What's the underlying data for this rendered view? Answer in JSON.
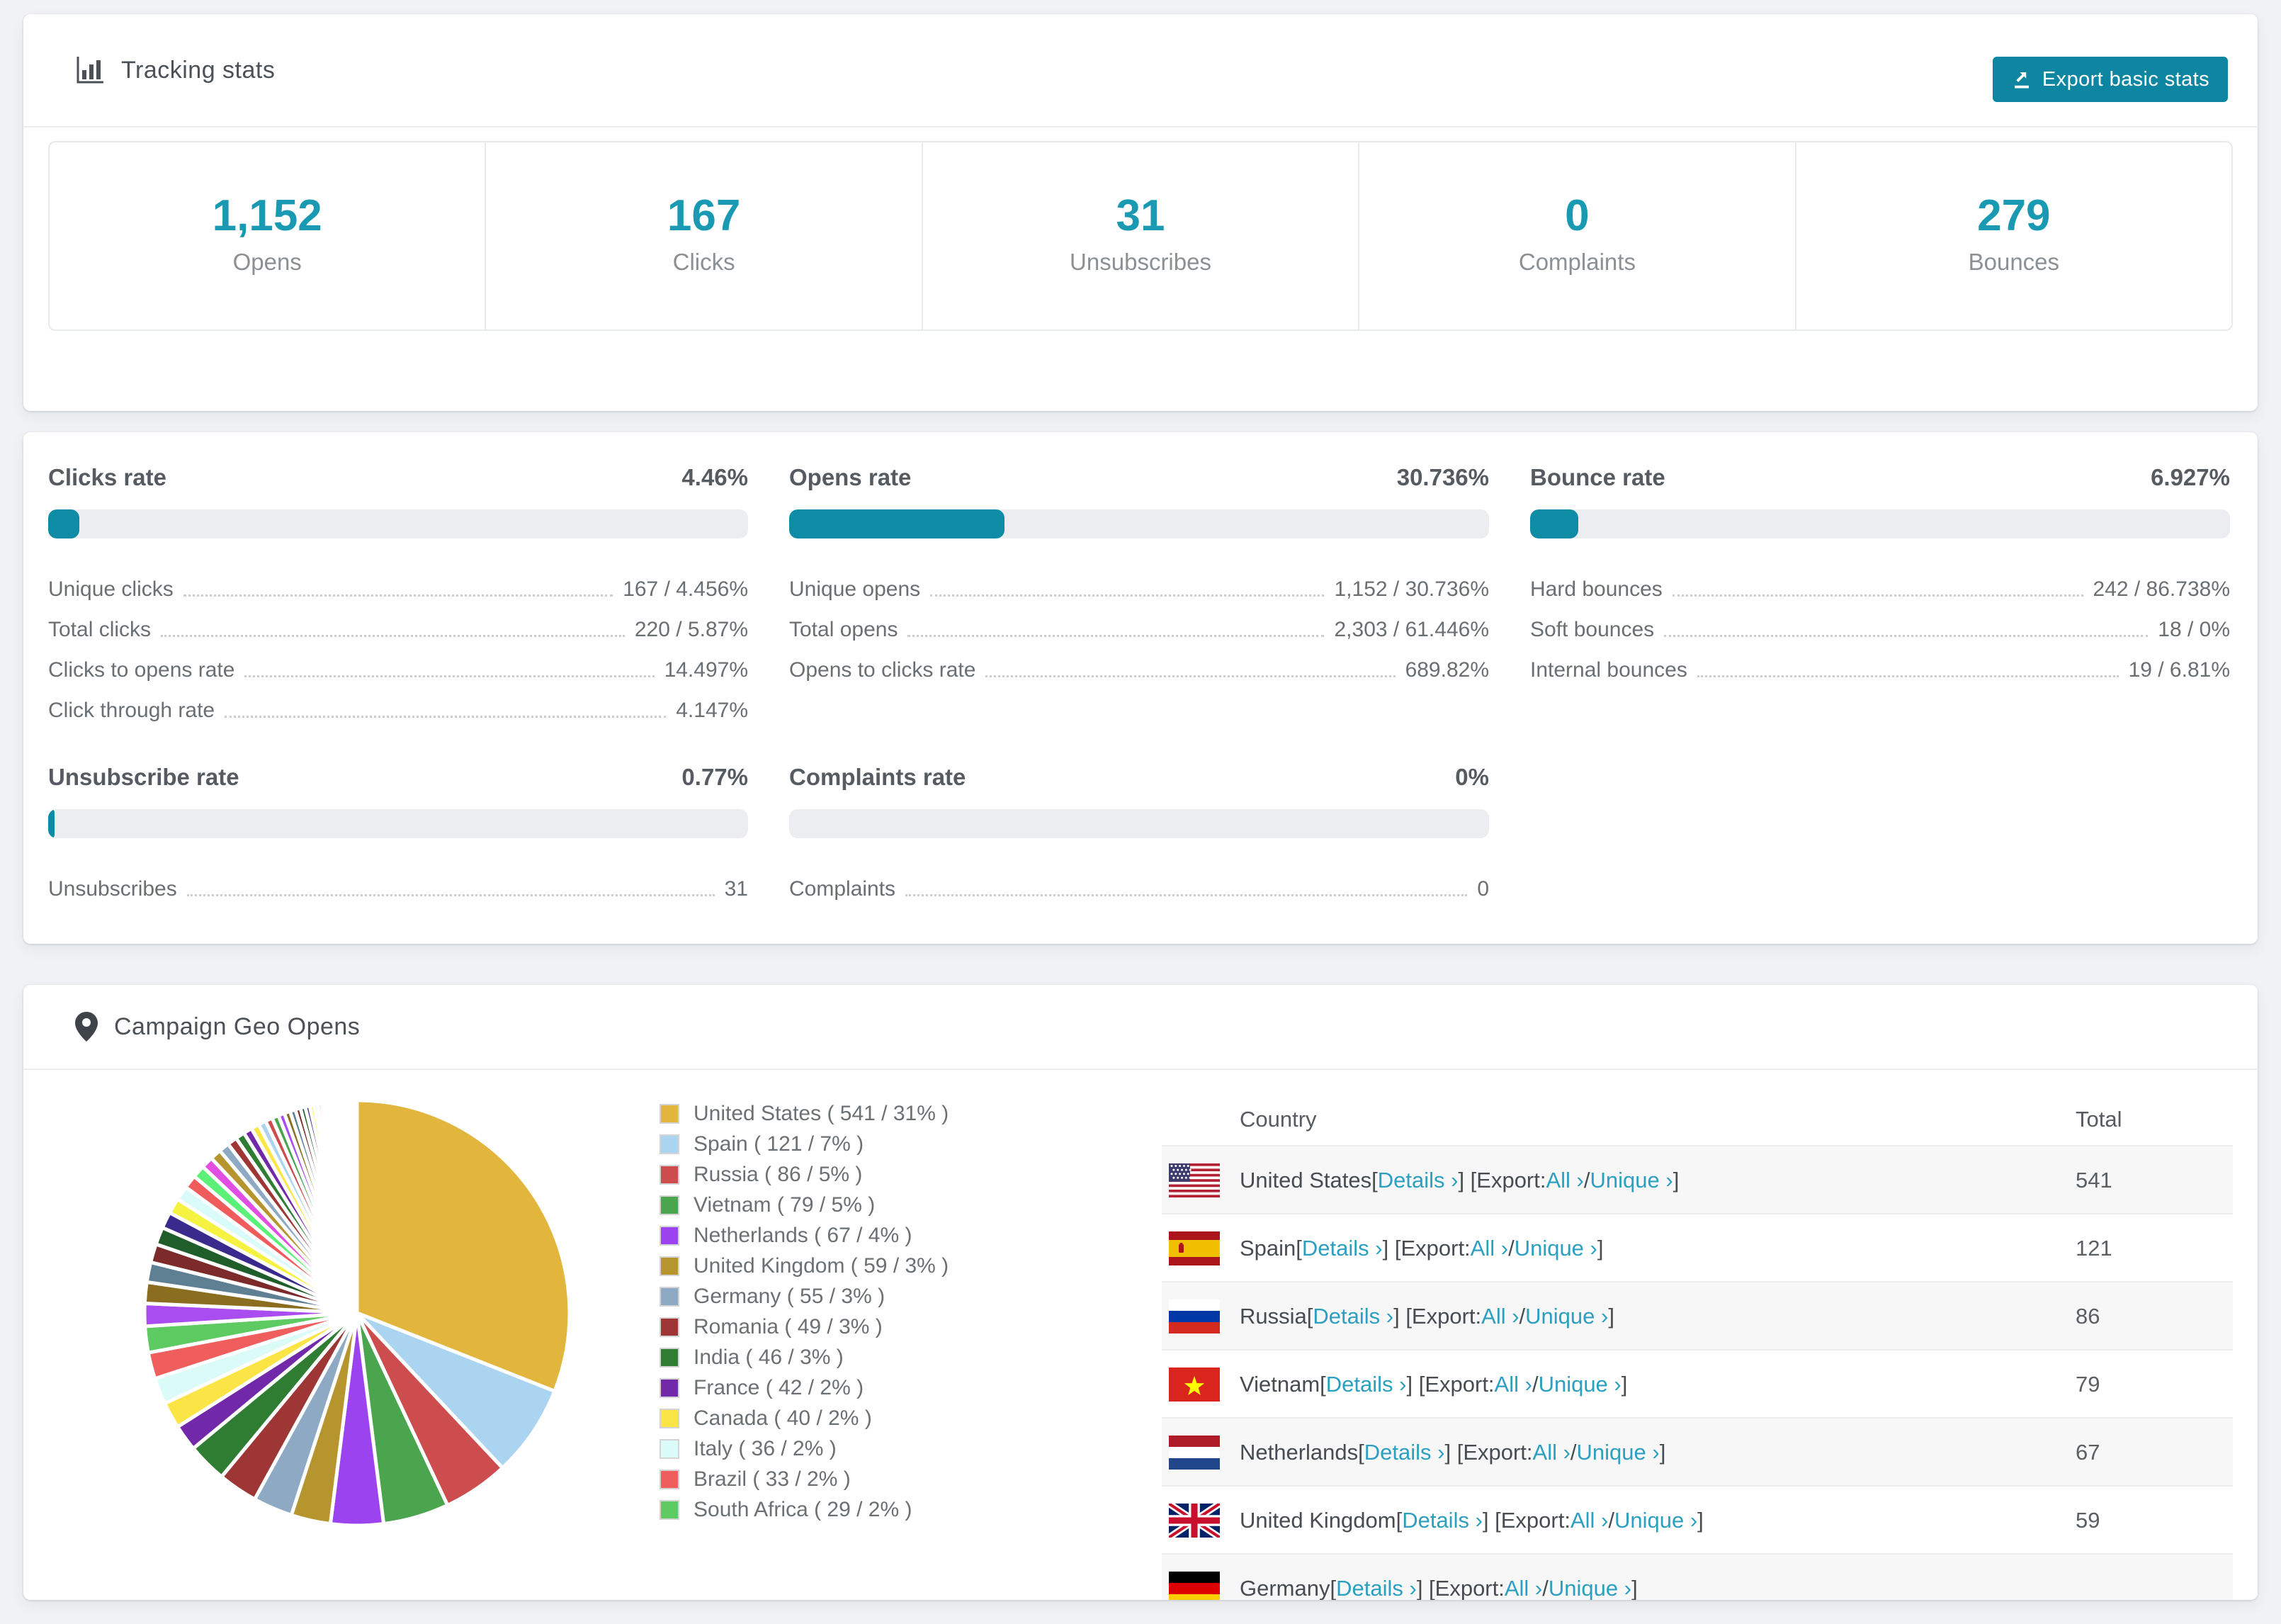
{
  "colors": {
    "accent_number": "#1a9ab2",
    "accent_button": "#0e86a1",
    "accent_bar": "#0e8ca6",
    "link": "#2d9fc0",
    "page_bg": "#f1f2f5"
  },
  "tracking": {
    "title": "Tracking stats",
    "export_button": "Export basic stats",
    "summary": [
      {
        "value": "1,152",
        "label": "Opens"
      },
      {
        "value": "167",
        "label": "Clicks"
      },
      {
        "value": "31",
        "label": "Unsubscribes"
      },
      {
        "value": "0",
        "label": "Complaints"
      },
      {
        "value": "279",
        "label": "Bounces"
      }
    ]
  },
  "rates": {
    "sections": [
      {
        "title": "Clicks rate",
        "value": "4.46%",
        "pct": 4.46,
        "rows": [
          {
            "label": "Unique clicks",
            "value": "167 / 4.456%"
          },
          {
            "label": "Total clicks",
            "value": "220 / 5.87%"
          },
          {
            "label": "Clicks to opens rate",
            "value": "14.497%"
          },
          {
            "label": "Click through rate",
            "value": "4.147%"
          }
        ]
      },
      {
        "title": "Opens rate",
        "value": "30.736%",
        "pct": 30.736,
        "rows": [
          {
            "label": "Unique opens",
            "value": "1,152 / 30.736%"
          },
          {
            "label": "Total opens",
            "value": "2,303 / 61.446%"
          },
          {
            "label": "Opens to clicks rate",
            "value": "689.82%"
          }
        ]
      },
      {
        "title": "Bounce rate",
        "value": "6.927%",
        "pct": 6.927,
        "rows": [
          {
            "label": "Hard bounces",
            "value": "242 / 86.738%"
          },
          {
            "label": "Soft bounces",
            "value": "18 / 0%"
          },
          {
            "label": "Internal bounces",
            "value": "19 / 6.81%"
          }
        ]
      },
      {
        "title": "Unsubscribe rate",
        "value": "0.77%",
        "pct": 0.77,
        "rows": [
          {
            "label": "Unsubscribes",
            "value": "31"
          }
        ]
      },
      {
        "title": "Complaints rate",
        "value": "0%",
        "pct": 0,
        "rows": [
          {
            "label": "Complaints",
            "value": "0"
          }
        ]
      }
    ]
  },
  "geo": {
    "title": "Campaign Geo Opens",
    "chart_data": {
      "type": "pie",
      "title": "Campaign Geo Opens",
      "unit": "opens",
      "start_angle": "top",
      "direction": "clockwise",
      "legend_position": "right",
      "slices": [
        {
          "label": "United States",
          "value": 541,
          "percent": 31,
          "color": "#e2b63d"
        },
        {
          "label": "Spain",
          "value": 121,
          "percent": 7,
          "color": "#abd4f1"
        },
        {
          "label": "Russia",
          "value": 86,
          "percent": 5,
          "color": "#cd4d4f"
        },
        {
          "label": "Vietnam",
          "value": 79,
          "percent": 5,
          "color": "#4ba44e"
        },
        {
          "label": "Netherlands",
          "value": 67,
          "percent": 4,
          "color": "#9b43ee"
        },
        {
          "label": "United Kingdom",
          "value": 59,
          "percent": 3,
          "color": "#b6952e"
        },
        {
          "label": "Germany",
          "value": 55,
          "percent": 3,
          "color": "#8da9c4"
        },
        {
          "label": "Romania",
          "value": 49,
          "percent": 3,
          "color": "#9e3636"
        },
        {
          "label": "India",
          "value": 46,
          "percent": 3,
          "color": "#2f7d33"
        },
        {
          "label": "France",
          "value": 42,
          "percent": 2,
          "color": "#7229a9"
        },
        {
          "label": "Canada",
          "value": 40,
          "percent": 2,
          "color": "#fbe445"
        },
        {
          "label": "Italy",
          "value": 36,
          "percent": 2,
          "color": "#dbfbf9"
        },
        {
          "label": "Brazil",
          "value": 33,
          "percent": 2,
          "color": "#f05d5d"
        },
        {
          "label": "South Africa",
          "value": 29,
          "percent": 2,
          "color": "#5ecb62"
        }
      ],
      "other_slices": {
        "note": "long tail of many small unlabeled countries",
        "count": 44,
        "total_percent": 26,
        "decay": 0.938,
        "colors": [
          "#a94df0",
          "#8a6d1f",
          "#5f7f93",
          "#7c2a2a",
          "#1f5e2a",
          "#3b2a8e",
          "#f5f241",
          "#d9fbfa",
          "#f05c5c",
          "#5bf077",
          "#e24de2",
          "#b6952e",
          "#8da9c4",
          "#9e3636",
          "#2f7d33",
          "#7229a9",
          "#fce646",
          "#abd4f1",
          "#cd4d4f",
          "#4ba44e"
        ]
      }
    },
    "legend": [
      {
        "label": "United States ( 541 / 31% )",
        "color": "#e2b63d"
      },
      {
        "label": "Spain ( 121 / 7% )",
        "color": "#abd4f1"
      },
      {
        "label": "Russia ( 86 / 5% )",
        "color": "#cd4d4f"
      },
      {
        "label": "Vietnam ( 79 / 5% )",
        "color": "#4ba44e"
      },
      {
        "label": "Netherlands ( 67 / 4% )",
        "color": "#9b43ee"
      },
      {
        "label": "United Kingdom ( 59 / 3% )",
        "color": "#b6952e"
      },
      {
        "label": "Germany ( 55 / 3% )",
        "color": "#8da9c4"
      },
      {
        "label": "Romania ( 49 / 3% )",
        "color": "#9e3636"
      },
      {
        "label": "India ( 46 / 3% )",
        "color": "#2f7d33"
      },
      {
        "label": "France ( 42 / 2% )",
        "color": "#7229a9"
      },
      {
        "label": "Canada ( 40 / 2% )",
        "color": "#fbe445"
      },
      {
        "label": "Italy ( 36 / 2% )",
        "color": "#dbfbf9"
      },
      {
        "label": "Brazil ( 33 / 2% )",
        "color": "#f05d5d"
      },
      {
        "label": "South Africa ( 29 / 2% )",
        "color": "#5ecb62"
      }
    ],
    "table": {
      "headers": {
        "country": "Country",
        "total": "Total"
      },
      "link_labels": {
        "details": "Details ›",
        "all": "All ›",
        "unique": "Unique ›"
      },
      "text_parts": {
        "open": " [",
        "export": "] [Export: ",
        "slash": " / ",
        "close": "]"
      },
      "rows": [
        {
          "country": "United States",
          "flag": "us",
          "total": "541"
        },
        {
          "country": "Spain",
          "flag": "es",
          "total": "121"
        },
        {
          "country": "Russia",
          "flag": "ru",
          "total": "86"
        },
        {
          "country": "Vietnam",
          "flag": "vn",
          "total": "79"
        },
        {
          "country": "Netherlands",
          "flag": "nl",
          "total": "67"
        },
        {
          "country": "United Kingdom",
          "flag": "gb",
          "total": "59"
        },
        {
          "country": "Germany",
          "flag": "de",
          "total": ""
        }
      ]
    }
  }
}
